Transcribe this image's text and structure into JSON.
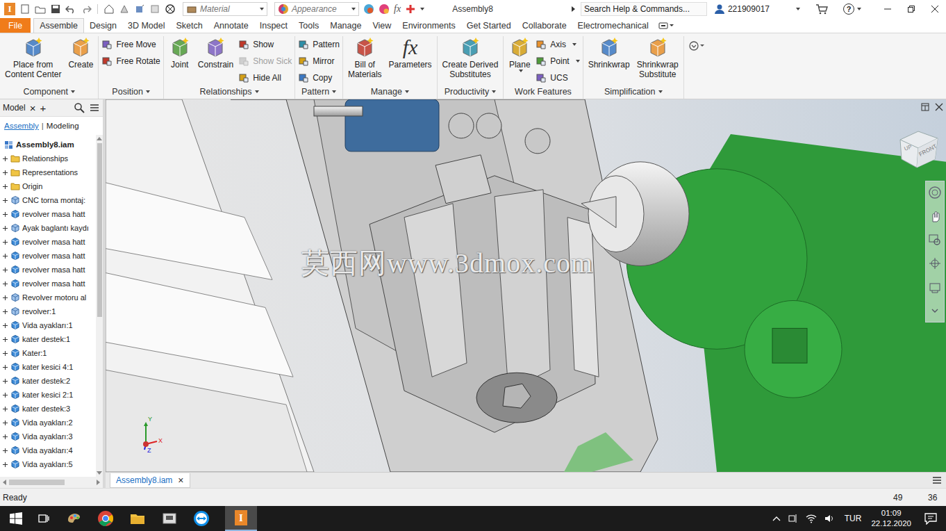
{
  "title_bar": {
    "app_logo": "I",
    "material": "Material",
    "appearance": "Appearance",
    "fx_glyph": "fx",
    "document": "Assembly8",
    "search": "Search Help & Commands...",
    "user": "221909017",
    "help": "?"
  },
  "ribbon_tabs": [
    {
      "label": "File",
      "kind": "file",
      "selected": false
    },
    {
      "label": "Assemble",
      "kind": "tab",
      "selected": true
    },
    {
      "label": "Design",
      "kind": "tab",
      "selected": false
    },
    {
      "label": "3D Model",
      "kind": "tab",
      "selected": false
    },
    {
      "label": "Sketch",
      "kind": "tab",
      "selected": false
    },
    {
      "label": "Annotate",
      "kind": "tab",
      "selected": false
    },
    {
      "label": "Inspect",
      "kind": "tab",
      "selected": false
    },
    {
      "label": "Tools",
      "kind": "tab",
      "selected": false
    },
    {
      "label": "Manage",
      "kind": "tab",
      "selected": false
    },
    {
      "label": "View",
      "kind": "tab",
      "selected": false
    },
    {
      "label": "Environments",
      "kind": "tab",
      "selected": false
    },
    {
      "label": "Get Started",
      "kind": "tab",
      "selected": false
    },
    {
      "label": "Collaborate",
      "kind": "tab",
      "selected": false
    },
    {
      "label": "Electromechanical",
      "kind": "tab",
      "selected": false
    }
  ],
  "ribbon_groups": [
    {
      "label": "Component",
      "has_menu": true,
      "tools": [
        {
          "lines": [
            "Place from",
            "Content Center"
          ],
          "kind": "large",
          "disabled": false,
          "dropdown": false
        },
        {
          "lines": [
            "Create"
          ],
          "kind": "large",
          "disabled": false,
          "dropdown": false
        }
      ]
    },
    {
      "label": "Position",
      "has_menu": true,
      "tools": [
        {
          "lines": [
            "Free Move"
          ],
          "kind": "small",
          "disabled": false,
          "dropdown": false
        },
        {
          "lines": [
            "Free Rotate"
          ],
          "kind": "small",
          "disabled": false,
          "dropdown": false
        }
      ]
    },
    {
      "label": "Relationships",
      "has_menu": true,
      "tools": [
        {
          "lines": [
            "Joint"
          ],
          "kind": "large",
          "disabled": false,
          "dropdown": false
        },
        {
          "lines": [
            "Constrain"
          ],
          "kind": "large",
          "disabled": false,
          "dropdown": false
        },
        {
          "lines": [
            "Show"
          ],
          "kind": "small",
          "disabled": false,
          "dropdown": false
        },
        {
          "lines": [
            "Show Sick"
          ],
          "kind": "small",
          "disabled": true,
          "dropdown": false
        },
        {
          "lines": [
            "Hide All"
          ],
          "kind": "small",
          "disabled": false,
          "dropdown": false
        }
      ]
    },
    {
      "label": "Pattern",
      "has_menu": true,
      "tools": [
        {
          "lines": [
            "Pattern"
          ],
          "kind": "small",
          "disabled": false,
          "dropdown": false
        },
        {
          "lines": [
            "Mirror"
          ],
          "kind": "small",
          "disabled": false,
          "dropdown": false
        },
        {
          "lines": [
            "Copy"
          ],
          "kind": "small",
          "disabled": false,
          "dropdown": false
        }
      ]
    },
    {
      "label": "Manage",
      "has_menu": true,
      "tools": [
        {
          "lines": [
            "Bill of",
            "Materials"
          ],
          "kind": "large",
          "disabled": false,
          "dropdown": false
        },
        {
          "lines": [
            "Parameters"
          ],
          "kind": "fx",
          "disabled": false,
          "dropdown": false
        }
      ]
    },
    {
      "label": "Productivity",
      "has_menu": true,
      "tools": [
        {
          "lines": [
            "Create Derived",
            "Substitutes"
          ],
          "kind": "large",
          "disabled": false,
          "dropdown": false
        }
      ]
    },
    {
      "label": "Work Features",
      "has_menu": false,
      "tools": [
        {
          "lines": [
            "Plane"
          ],
          "kind": "large",
          "disabled": false,
          "dropdown": true
        },
        {
          "lines": [
            "Axis"
          ],
          "kind": "small",
          "disabled": false,
          "dropdown": true
        },
        {
          "lines": [
            "Point"
          ],
          "kind": "small",
          "disabled": false,
          "dropdown": true
        },
        {
          "lines": [
            "UCS"
          ],
          "kind": "small",
          "disabled": false,
          "dropdown": false
        }
      ]
    },
    {
      "label": "Simplification",
      "has_menu": true,
      "tools": [
        {
          "lines": [
            "Shrinkwrap"
          ],
          "kind": "large",
          "disabled": false,
          "dropdown": false
        },
        {
          "lines": [
            "Shrinkwrap",
            "Substitute"
          ],
          "kind": "large",
          "disabled": false,
          "dropdown": false
        }
      ]
    }
  ],
  "browser": {
    "tab": "Model",
    "close": "×",
    "add": "+",
    "separator": "|",
    "modes": [
      {
        "label": "Assembly",
        "selected": true
      },
      {
        "label": "Modeling",
        "selected": false
      }
    ],
    "items": [
      {
        "label": "Assembly8.iam",
        "kind": "root",
        "expandable": false,
        "expanded": true
      },
      {
        "label": "Relationships",
        "kind": "folder",
        "expandable": true,
        "expanded": false
      },
      {
        "label": "Representations",
        "kind": "folder",
        "expandable": true,
        "expanded": false
      },
      {
        "label": "Origin",
        "kind": "folder",
        "expandable": true,
        "expanded": false
      },
      {
        "label": "CNC torna montaj:",
        "kind": "assembly",
        "expandable": true,
        "expanded": false
      },
      {
        "label": "revolver masa hatt",
        "kind": "part",
        "expandable": true,
        "expanded": false
      },
      {
        "label": "Ayak baglantı kaydı",
        "kind": "assembly",
        "expandable": true,
        "expanded": false
      },
      {
        "label": "revolver masa hatt",
        "kind": "part",
        "expandable": true,
        "expanded": false
      },
      {
        "label": "revolver masa hatt",
        "kind": "part",
        "expandable": true,
        "expanded": false
      },
      {
        "label": "revolver masa hatt",
        "kind": "part",
        "expandable": true,
        "expanded": false
      },
      {
        "label": "revolver masa hatt",
        "kind": "part",
        "expandable": true,
        "expanded": false
      },
      {
        "label": "Revolver motoru al",
        "kind": "assembly",
        "expandable": true,
        "expanded": false
      },
      {
        "label": "revolver:1",
        "kind": "assembly",
        "expandable": true,
        "expanded": false
      },
      {
        "label": "Vida ayakları:1",
        "kind": "part",
        "expandable": true,
        "expanded": false
      },
      {
        "label": "kater destek:1",
        "kind": "part",
        "expandable": true,
        "expanded": false
      },
      {
        "label": "Kater:1",
        "kind": "part",
        "expandable": true,
        "expanded": false
      },
      {
        "label": "kater kesici 4:1",
        "kind": "part",
        "expandable": true,
        "expanded": false
      },
      {
        "label": "kater destek:2",
        "kind": "part",
        "expandable": true,
        "expanded": false
      },
      {
        "label": "kater kesici 2:1",
        "kind": "part",
        "expandable": true,
        "expanded": false
      },
      {
        "label": "kater destek:3",
        "kind": "part",
        "expandable": true,
        "expanded": false
      },
      {
        "label": "Vida ayakları:2",
        "kind": "part",
        "expandable": true,
        "expanded": false
      },
      {
        "label": "Vida ayakları:3",
        "kind": "part",
        "expandable": true,
        "expanded": false
      },
      {
        "label": "Vida ayakları:4",
        "kind": "part",
        "expandable": true,
        "expanded": false
      },
      {
        "label": "Vida ayakları:5",
        "kind": "part",
        "expandable": true,
        "expanded": false
      }
    ]
  },
  "viewport": {
    "watermark": "莫西网www.3dmox.com",
    "viewcube": {
      "front": "FRONT",
      "up": "UP"
    },
    "axes": {
      "x": "X",
      "y": "Y",
      "z": "Z"
    }
  },
  "document_tabs": [
    {
      "label": "Assembly8.iam",
      "selected": true,
      "close": "×"
    }
  ],
  "status_bar": {
    "text": "Ready",
    "value_a": "49",
    "value_b": "36"
  },
  "taskbar": {
    "language": "TUR",
    "time": "01:09",
    "date": "22.12.2020"
  }
}
